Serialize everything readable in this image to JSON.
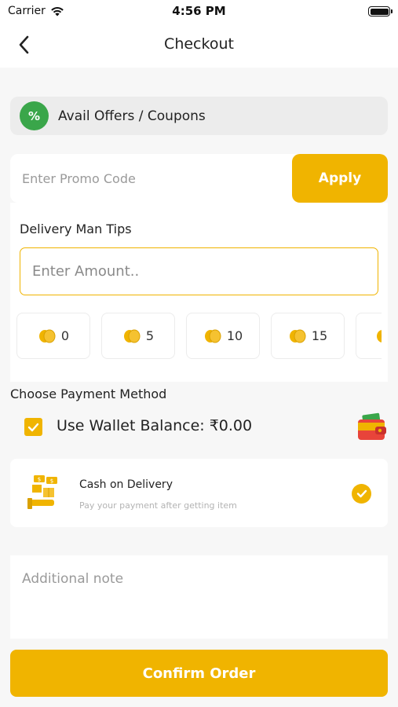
{
  "status_bar": {
    "carrier": "Carrier",
    "time": "4:56 PM"
  },
  "nav": {
    "title": "Checkout",
    "back_icon": "chevron-left-icon"
  },
  "offers": {
    "icon_text": "%",
    "label": "Avail Offers / Coupons",
    "icon_color": "#3aa64a"
  },
  "promo": {
    "placeholder": "Enter Promo Code",
    "apply_label": "Apply"
  },
  "tips": {
    "heading": "Delivery Man Tips",
    "amount_placeholder": "Enter Amount..",
    "options": [
      "0",
      "5",
      "10",
      "15"
    ]
  },
  "payment": {
    "heading": "Choose Payment Method",
    "wallet_label": "Use Wallet Balance: ₹0.00",
    "wallet_checked": true,
    "cod_title": "Cash on Delivery",
    "cod_subtitle": "Pay your payment after getting item",
    "cod_selected": true
  },
  "note": {
    "placeholder": "Additional note"
  },
  "confirm": {
    "label": "Confirm Order"
  },
  "colors": {
    "accent": "#f0b400",
    "background": "#f7f7f7",
    "offer_green": "#3aa64a"
  }
}
